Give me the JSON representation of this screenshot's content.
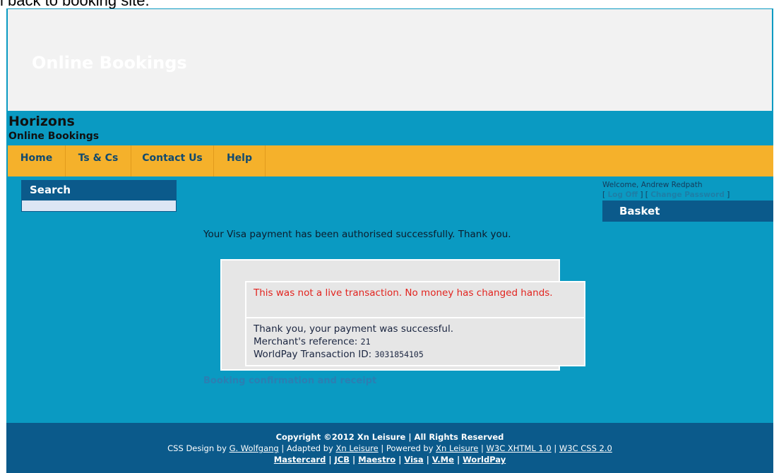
{
  "page_caption": "l back to booking site.",
  "banner": {
    "title": "Online Bookings"
  },
  "site": {
    "name": "Horizons",
    "subtitle": "Online Bookings"
  },
  "nav": [
    {
      "label": "Home"
    },
    {
      "label": "Ts & Cs"
    },
    {
      "label": "Contact Us"
    },
    {
      "label": "Help"
    }
  ],
  "search": {
    "title": "Search"
  },
  "account": {
    "welcome": "Welcome, Andrew Redpath",
    "log_off": "Log Off",
    "change_password": "Change Password",
    "open_bracket": "[",
    "close_bracket": "]"
  },
  "basket": {
    "title": "Basket"
  },
  "payment": {
    "authorised_message": "Your Visa payment has been authorised successfully. Thank you.",
    "test_notice": "This was not a live transaction. No money has changed hands.",
    "success_line": "Thank you, your payment was successful.",
    "merchant_ref_label": "Merchant's reference:",
    "merchant_ref_value": "21",
    "txn_id_label": "WorldPay Transaction ID:",
    "txn_id_value": "3031854105"
  },
  "confirmation": {
    "title": "Booking confirmation and receipt"
  },
  "footer": {
    "copyright": "Copyright ©2012 Xn Leisure | All Rights Reserved",
    "design_by_label": "CSS Design by",
    "designer": "G. Wolfgang",
    "adapted_label": "| Adapted by",
    "adapter": "Xn Leisure",
    "powered_label": "| Powered by",
    "powered": "Xn Leisure",
    "sep": "|",
    "xhtml": "W3C XHTML 1.0",
    "css": "W3C CSS 2.0",
    "cards": [
      "Mastercard",
      "JCB",
      "Maestro",
      "Visa",
      "V.Me",
      "WorldPay"
    ]
  }
}
